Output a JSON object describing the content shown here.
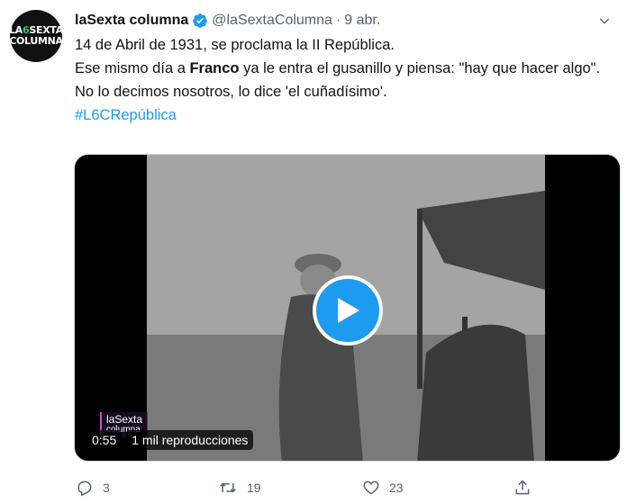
{
  "author": {
    "display_name": "laSexta columna",
    "handle": "@laSextaColumna",
    "separator": "·",
    "time": "9 abr.",
    "avatar_text": [
      "LA",
      "6",
      "SEXTA",
      "COLUMNA"
    ]
  },
  "tweet": {
    "line1": "14 de Abril de 1931, se proclama la II República.",
    "line2_before": "Ese mismo día a ",
    "line2_bold": "Franco",
    "line2_after": " ya le entra el gusanillo y piensa: \"hay que hacer algo\".",
    "line3": "No lo decimos nosotros, lo dice 'el cuñadísimo'.",
    "hashtag": "#L6CRepública"
  },
  "video": {
    "duration": "0:55",
    "views": "1 mil reproducciones",
    "watermark_line1": "laSexta",
    "watermark_line2": "columna",
    "play_color": "#1d9bf0"
  },
  "actions": {
    "reply_count": "3",
    "retweet_count": "19",
    "like_count": "23"
  },
  "colors": {
    "accent": "#1d9bf0",
    "secondary_text": "#536471"
  }
}
